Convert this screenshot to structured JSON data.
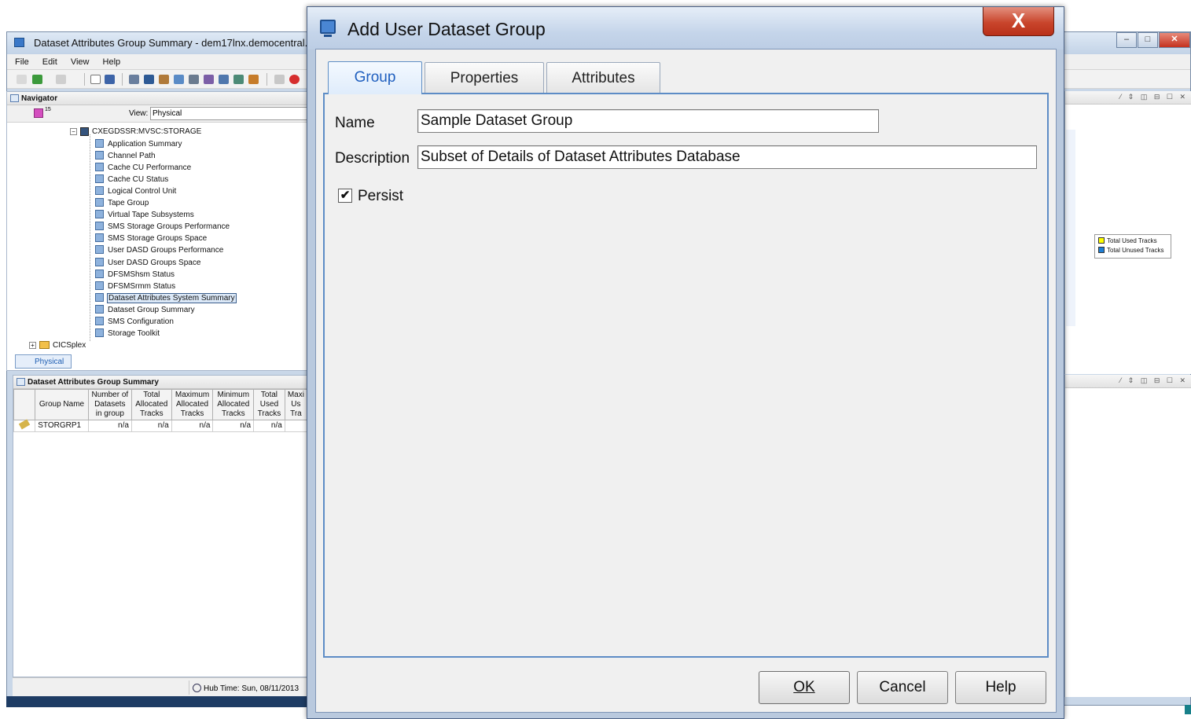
{
  "background": {
    "heading_fragment": "",
    "window_title": "Dataset Attributes Group Summary - dem17lnx.democentral.ibm",
    "menu": [
      "File",
      "Edit",
      "View",
      "Help"
    ],
    "navigator": {
      "title": "Navigator",
      "view_label": "View:",
      "view_value": "Physical",
      "badge_count": "15",
      "root": "CXEGDSSR:MVSC:STORAGE",
      "items": [
        "Application Summary",
        "Channel Path",
        "Cache CU Performance",
        "Cache CU Status",
        "Logical Control Unit",
        "Tape Group",
        "Virtual Tape Subsystems",
        "SMS Storage Groups Performance",
        "SMS Storage Groups Space",
        "User DASD Groups Performance",
        "User DASD Groups Space",
        "DFSMShsm Status",
        "DFSMSrmm Status",
        "Dataset Attributes System Summary",
        "Dataset Group Summary",
        "SMS Configuration",
        "Storage Toolkit"
      ],
      "selected_index": 13,
      "sibling": "CICSplex",
      "tab": "Physical"
    },
    "summary": {
      "title": "Dataset Attributes Group Summary",
      "columns": [
        "Group Name",
        "Number of Datasets in group",
        "Total Allocated Tracks",
        "Maximum Allocated Tracks",
        "Minimum Allocated Tracks",
        "Total Used Tracks",
        "Maxi Us Tra"
      ],
      "rows": [
        [
          "STORGRP1",
          "n/a",
          "n/a",
          "n/a",
          "n/a",
          "n/a",
          ""
        ]
      ]
    },
    "status": {
      "hub_time": "Hub Time: Sun, 08/11/2013"
    },
    "legend": [
      {
        "label": "Total Used Tracks",
        "color": "#ffff00"
      },
      {
        "label": "Total Unused Tracks",
        "color": "#1e7fd6"
      }
    ]
  },
  "dialog": {
    "title": "Add User Dataset Group",
    "close_glyph": "X",
    "tabs": [
      {
        "label": "Group",
        "active": true
      },
      {
        "label": "Properties",
        "active": false
      },
      {
        "label": "Attributes",
        "active": false
      }
    ],
    "fields": {
      "name_label": "Name",
      "name_value": "Sample Dataset Group",
      "description_label": "Description",
      "description_value": "Subset of Details of Dataset Attributes Database",
      "persist_label": "Persist",
      "persist_checked": true
    },
    "buttons": {
      "ok_label": "OK",
      "cancel_label": "Cancel",
      "help_label": "Help"
    }
  },
  "colors": {
    "active_tab_text": "#1f5fbf",
    "panel_border": "#5d8cc6",
    "close_button": "#c9452c"
  },
  "icons": [
    "app-window-icon",
    "dialog-monitor-icon",
    "close-icon",
    "checkbox-check-icon",
    "tree-node-icon",
    "folder-icon",
    "clock-icon",
    "edit-pencil-icon"
  ]
}
